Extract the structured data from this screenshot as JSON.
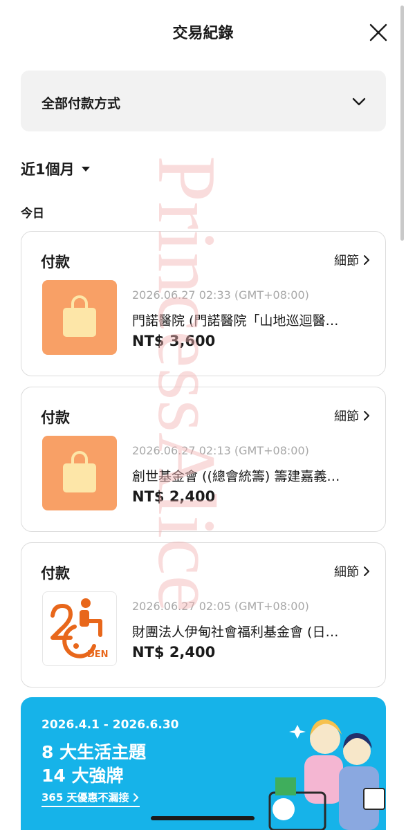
{
  "header": {
    "title": "交易紀錄"
  },
  "filter": {
    "label": "全部付款方式"
  },
  "period": {
    "label": "近1個月"
  },
  "section": {
    "today_label": "今日"
  },
  "transactions": [
    {
      "type": "付款",
      "detail_label": "細節",
      "time": "2026.06.27 02:33 (GMT+08:00)",
      "name": "門諾醫院 (門諾醫院「山地巡迴醫…",
      "amount": "NT$ 3,600",
      "icon": "shopping-bag-icon"
    },
    {
      "type": "付款",
      "detail_label": "細節",
      "time": "2026.06.27 02:13 (GMT+08:00)",
      "name": "創世基金會 ((總會統籌) 籌建嘉義…",
      "amount": "NT$ 2,400",
      "icon": "shopping-bag-icon"
    },
    {
      "type": "付款",
      "detail_label": "細節",
      "time": "2026.06.27 02:05 (GMT+08:00)",
      "name": "財團法人伊甸社會福利基金會 (日…",
      "amount": "NT$ 2,400",
      "icon": "eden-logo-icon"
    }
  ],
  "banner": {
    "date_range": "2026.4.1 - 2026.6.30",
    "line1": "8 大生活主題",
    "line2": "14 大強牌",
    "link": "365 天優惠不漏接"
  },
  "watermark": {
    "text": "PrincessAlice"
  },
  "colors": {
    "banner_bg": "#16b3e9",
    "bag_bg": "#f8a066",
    "eden_orange": "#e8671b"
  }
}
